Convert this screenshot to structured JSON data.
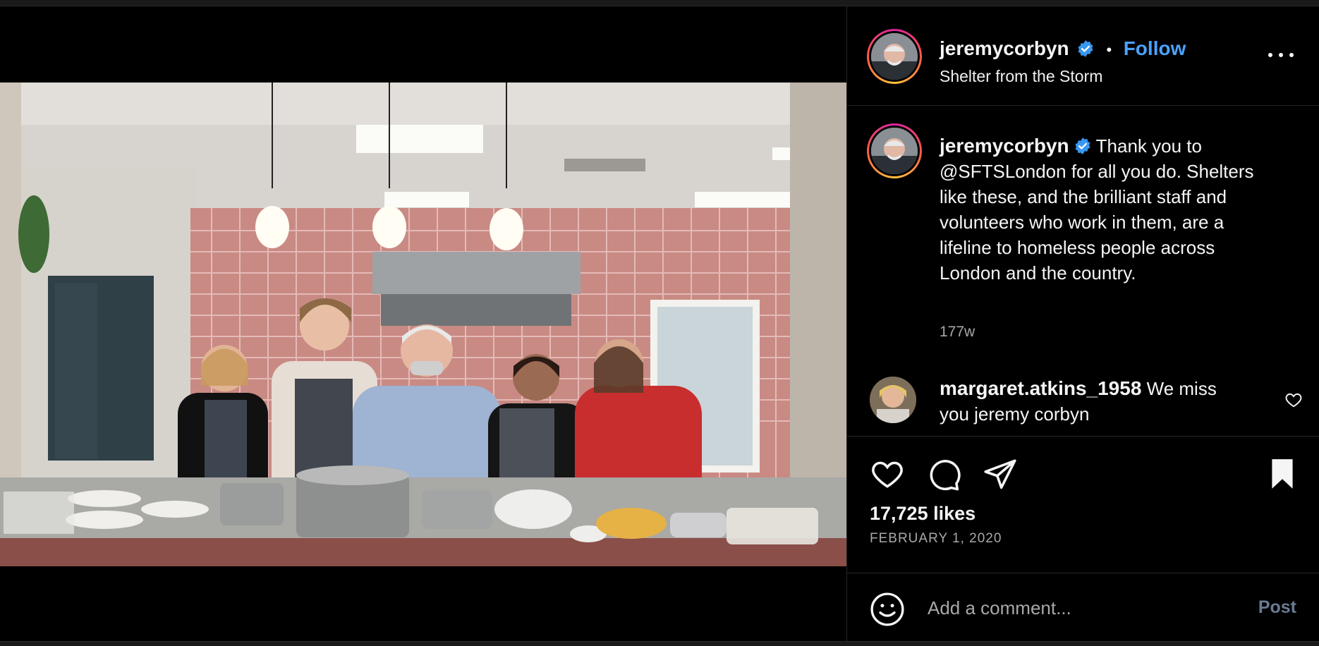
{
  "post": {
    "author": "jeremycorbyn",
    "location": "Shelter from the Storm",
    "follow_label": "Follow",
    "separator": "•"
  },
  "caption": {
    "author": "jeremycorbyn",
    "text": "Thank you to @SFTSLondon for all you do. Shelters like these, and the brilliant staff and volunteers who work in them, are a lifeline to homeless people across London and the country.",
    "age": "177w"
  },
  "comments": [
    {
      "author": "margaret.atkins_1958",
      "text": "We miss you jeremy corbyn"
    }
  ],
  "engagement": {
    "likes": "17,725 likes",
    "date": "FEBRUARY 1, 2020"
  },
  "add_comment": {
    "placeholder": "Add a comment...",
    "post_label": "Post"
  },
  "icons": {
    "verified": "verified-badge-icon",
    "more": "more-options-icon",
    "like": "heart-icon",
    "comment": "comment-bubble-icon",
    "share": "paper-plane-icon",
    "save": "bookmark-filled-icon",
    "emoji": "smiley-icon"
  },
  "colors": {
    "accent_link": "#4aa3ff",
    "verified": "#3897f0",
    "post_disabled": "#6a7b94",
    "background": "#000000"
  }
}
